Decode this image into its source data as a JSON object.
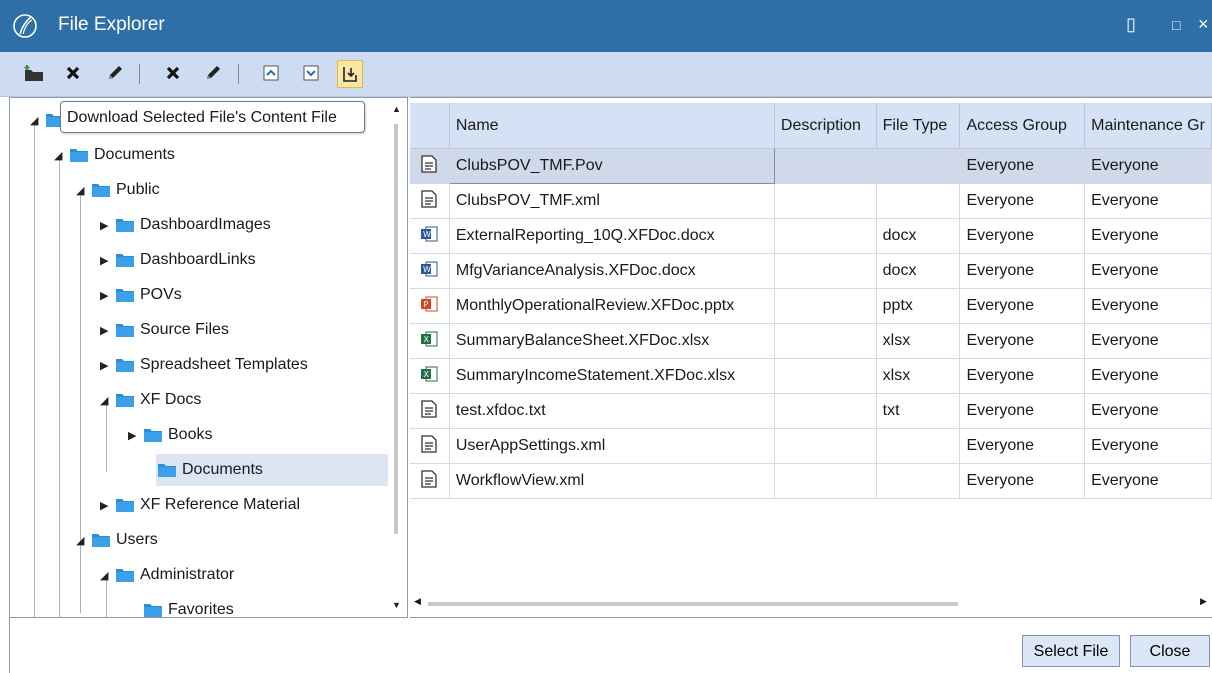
{
  "window": {
    "title": "File Explorer",
    "title_buttons": [
      "▯",
      "□",
      "×"
    ]
  },
  "toolbar": {
    "tooltip": "Download Selected File's Content File",
    "tools": [
      "add-folder",
      "delete-folder",
      "rename-folder",
      "delete-file",
      "edit-file",
      "upload-file",
      "download-file",
      "download-content-file"
    ]
  },
  "tree": {
    "items": [
      {
        "label": "",
        "level": 0,
        "expanded": true
      },
      {
        "label": "Documents",
        "level": 1,
        "expanded": true
      },
      {
        "label": "Public",
        "level": 2,
        "expanded": true
      },
      {
        "label": "DashboardImages",
        "level": 3,
        "expanded": false
      },
      {
        "label": "DashboardLinks",
        "level": 3,
        "expanded": false
      },
      {
        "label": "POVs",
        "level": 3,
        "expanded": false
      },
      {
        "label": "Source Files",
        "level": 3,
        "expanded": false
      },
      {
        "label": "Spreadsheet Templates",
        "level": 3,
        "expanded": false
      },
      {
        "label": "XF Docs",
        "level": 3,
        "expanded": true
      },
      {
        "label": "Books",
        "level": 4,
        "expanded": false
      },
      {
        "label": "Documents",
        "level": 4,
        "selected": true
      },
      {
        "label": "XF Reference Material",
        "level": 3,
        "expanded": false
      },
      {
        "label": "Users",
        "level": 2,
        "expanded": true
      },
      {
        "label": "Administrator",
        "level": 3,
        "expanded": true
      },
      {
        "label": "Favorites",
        "level": 4
      }
    ]
  },
  "grid": {
    "columns": [
      "Name",
      "Description",
      "File Type",
      "Access Group",
      "Maintenance Gr"
    ],
    "rows": [
      {
        "icon": "text",
        "name": "ClubsPOV_TMF.Pov",
        "description": "",
        "file_type": "",
        "access": "Everyone",
        "maintenance": "Everyone",
        "selected": true
      },
      {
        "icon": "text",
        "name": "ClubsPOV_TMF.xml",
        "description": "",
        "file_type": "",
        "access": "Everyone",
        "maintenance": "Everyone"
      },
      {
        "icon": "word",
        "name": "ExternalReporting_10Q.XFDoc.docx",
        "description": "",
        "file_type": "docx",
        "access": "Everyone",
        "maintenance": "Everyone"
      },
      {
        "icon": "word",
        "name": "MfgVarianceAnalysis.XFDoc.docx",
        "description": "",
        "file_type": "docx",
        "access": "Everyone",
        "maintenance": "Everyone"
      },
      {
        "icon": "powerpoint",
        "name": "MonthlyOperationalReview.XFDoc.pptx",
        "description": "",
        "file_type": "pptx",
        "access": "Everyone",
        "maintenance": "Everyone"
      },
      {
        "icon": "excel",
        "name": "SummaryBalanceSheet.XFDoc.xlsx",
        "description": "",
        "file_type": "xlsx",
        "access": "Everyone",
        "maintenance": "Everyone"
      },
      {
        "icon": "excel",
        "name": "SummaryIncomeStatement.XFDoc.xlsx",
        "description": "",
        "file_type": "xlsx",
        "access": "Everyone",
        "maintenance": "Everyone"
      },
      {
        "icon": "text",
        "name": "test.xfdoc.txt",
        "description": "",
        "file_type": "txt",
        "access": "Everyone",
        "maintenance": "Everyone"
      },
      {
        "icon": "text",
        "name": "UserAppSettings.xml",
        "description": "",
        "file_type": "",
        "access": "Everyone",
        "maintenance": "Everyone"
      },
      {
        "icon": "text",
        "name": "WorkflowView.xml",
        "description": "",
        "file_type": "",
        "access": "Everyone",
        "maintenance": "Everyone"
      }
    ]
  },
  "buttons": {
    "select_file": "Select File",
    "close": "Close"
  },
  "colors": {
    "titlebar": "#2f6fa8",
    "toolbar": "#cddcf2",
    "header": "#d5e1f4",
    "selection": "#cfd9e9",
    "folder": "#2a8ed6"
  }
}
